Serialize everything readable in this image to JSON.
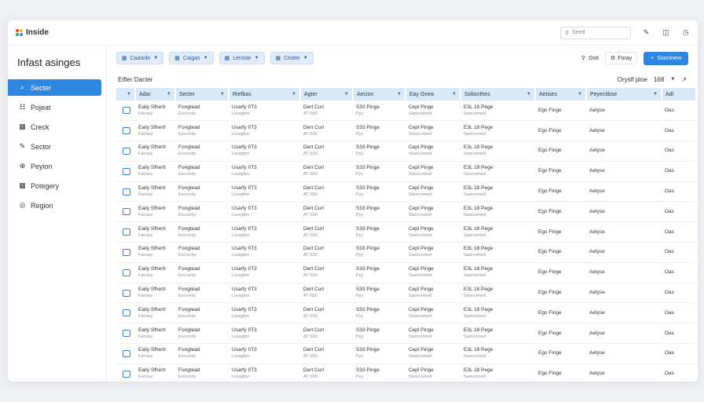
{
  "app": {
    "name": "Inside",
    "search_placeholder": "Seed"
  },
  "page_title": "Infast asinges",
  "sidebar": {
    "items": [
      {
        "label": "Secter",
        "icon": "search-icon",
        "active": true
      },
      {
        "label": "Pojeat",
        "icon": "grid-icon",
        "active": false
      },
      {
        "label": "Creck",
        "icon": "calendar-icon",
        "active": false
      },
      {
        "label": "Sector",
        "icon": "edit-icon",
        "active": false
      },
      {
        "label": "Peyion",
        "icon": "globe-icon",
        "active": false
      },
      {
        "label": "Potegery",
        "icon": "calendar-icon",
        "active": false
      },
      {
        "label": "Region",
        "icon": "circle-icon",
        "active": false
      }
    ]
  },
  "toolbar": {
    "filters": [
      "Caaside",
      "Caigas",
      "Leroste",
      "Ceatte"
    ],
    "filter_label": "Ooti",
    "settings_label": "Foray",
    "primary_label": "Sooninew"
  },
  "subbar": {
    "left": "Eifter Dacter",
    "right_label": "Oryslf ploe",
    "count": "168"
  },
  "table": {
    "columns": [
      "Adar",
      "Secter",
      "Riefbas",
      "Agter",
      "Aecion",
      "Eay Onea",
      "Solionthes",
      "Aetises",
      "Peyectibse",
      "Adl"
    ],
    "rows": [
      [
        "Eaily Sfhertl",
        "Farrasy",
        "Fongtead",
        "Exccenty",
        "Usarfy 0T3",
        "Lessgfon",
        "Dert Curl",
        "AT S50",
        "S33 Pinge",
        "Pyy",
        "Cepl Pinge",
        "Siarecomed",
        "E3L 18 Pege",
        "Sarecomed",
        "Ego Finge",
        "Aetyse",
        "Oas"
      ],
      [
        "Eaily Sfhertl",
        "Farrasy",
        "Fongtead",
        "Exccenty",
        "Usarfy 0T3",
        "Lessgfon",
        "Dert Curl",
        "AT S50",
        "S33 Pinge",
        "Pyy",
        "Cepl Pinge",
        "Siarecomed",
        "E3L 18 Pege",
        "Sarecomed",
        "Ego Finge",
        "Aetyse",
        "Oas"
      ],
      [
        "Eaily Sfhertl",
        "Farrasy",
        "Fongtead",
        "Exccenty",
        "Usarfy 0T3",
        "Lessgfon",
        "Dert Curl",
        "AT S50",
        "S33 Pinge",
        "Pyy",
        "Cepl Pinge",
        "Siarecomed",
        "E3L 18 Pege",
        "Sarecomed",
        "Ego Finge",
        "Aetyse",
        "Oas"
      ],
      [
        "Eaily Sfhertl",
        "Farrasy",
        "Fongtead",
        "Exccenty",
        "Usarfy 0T3",
        "Lessgfon",
        "Dert Curl",
        "AT S50",
        "S33 Pinge",
        "Pyy",
        "Cepl Pinge",
        "Siarecomed",
        "E3L 18 Pege",
        "Sarecomed",
        "Ego Finge",
        "Aetyse",
        "Oas"
      ],
      [
        "Eaily Sfhertl",
        "Farrasy",
        "Fongtead",
        "Exccenty",
        "Usarfy 0T3",
        "Lessgfon",
        "Dert Curl",
        "AT S50",
        "S33 Pinge",
        "Pyy",
        "Cepl Pinge",
        "Siarecomed",
        "E3L 18 Pege",
        "Sarecomed",
        "Ego Finge",
        "Aetyse",
        "Oas"
      ],
      [
        "Eaily Sfhertl",
        "Farrasy",
        "Fongtead",
        "Exccenty",
        "Usarfy 0T3",
        "Lessgfon",
        "Dert Curl",
        "AT S50",
        "S33 Pinge",
        "Pyy",
        "Cepl Pinge",
        "Siarecomed",
        "E3L 18 Pege",
        "Sarecomed",
        "Ego Finge",
        "Aetyse",
        "Oas"
      ],
      [
        "Eaily Sfhertl",
        "Farrasy",
        "Fongtead",
        "Exccenty",
        "Usarfy 0T3",
        "Lessgfon",
        "Dert Curl",
        "AT S50",
        "S33 Pinge",
        "Pyy",
        "Cepl Pinge",
        "Siarecomed",
        "E3L 18 Pege",
        "Sarecomed",
        "Ego Finge",
        "Aetyse",
        "Oas"
      ],
      [
        "Eaily Sfhertl",
        "Farrasy",
        "Fongtead",
        "Exccenty",
        "Usarfy 0T3",
        "Lessgfon",
        "Dert Curl",
        "AT S50",
        "S33 Pinge",
        "Pyy",
        "Cepl Pinge",
        "Siarecomed",
        "E3L 18 Pege",
        "Sarecomed",
        "Ego Finge",
        "Aetyse",
        "Oas"
      ],
      [
        "Eaily Sfhertl",
        "Farrasy",
        "Fongtead",
        "Exccenty",
        "Usarfy 0T3",
        "Lessgfon",
        "Dert Curl",
        "AT S50",
        "S33 Pinge",
        "Pyy",
        "Cepl Pinge",
        "Siarecomed",
        "E3L 18 Pege",
        "Sarecomed",
        "Ego Finge",
        "Aetyse",
        "Oas"
      ],
      [
        "Eaily Sfhertl",
        "Farrasy",
        "Fongtead",
        "Exccenty",
        "Usarfy 0T3",
        "Lessgfon",
        "Dert Curl",
        "AT S50",
        "S33 Pinge",
        "Pyy",
        "Cepl Pinge",
        "Siarecomed",
        "E3L 18 Pege",
        "Sarecomed",
        "Ego Finge",
        "Aetyse",
        "Oas"
      ],
      [
        "Eaily Sfhertl",
        "Farrasy",
        "Fongtead",
        "Exccenty",
        "Usarfy 0T3",
        "Lessgfon",
        "Dert Curl",
        "AT S50",
        "S33 Pinge",
        "Pyy",
        "Cepl Pinge",
        "Siarecomed",
        "E3L 18 Pege",
        "Sarecomed",
        "Ego Finge",
        "Aetyse",
        "Oas"
      ],
      [
        "Eaily Sfhertl",
        "Farrasy",
        "Fongtead",
        "Exccenty",
        "Usarfy 0T3",
        "Lessgfon",
        "Dert Curl",
        "AT S50",
        "S33 Pinge",
        "Pyy",
        "Cepl Pinge",
        "Siarecomed",
        "E3L 18 Pege",
        "Sarecomed",
        "Ego Finge",
        "Aetyse",
        "Oas"
      ],
      [
        "Eaily Sfhertl",
        "Farrasy",
        "Fongtead",
        "Exccenty",
        "Usarfy 0T3",
        "Lessgfon",
        "Dert Curl",
        "AT S50",
        "S33 Pinge",
        "Pyy",
        "Cepl Pinge",
        "Siarecomed",
        "E3L 18 Pege",
        "Sarecomed",
        "Ego Finge",
        "Aetyse",
        "Oas"
      ],
      [
        "Eaily Sfhertl",
        "Farrasy",
        "Fongtead",
        "Exccenty",
        "Usarfy 0T3",
        "Lessgfon",
        "Dert Curl",
        "AT S50",
        "S33 Pinge",
        "Pyy",
        "Cepl Pinge",
        "Siarecomed",
        "E3L 18 Pege",
        "Sarecomed",
        "Ego Finge",
        "Aetyse",
        "Oas"
      ]
    ]
  }
}
